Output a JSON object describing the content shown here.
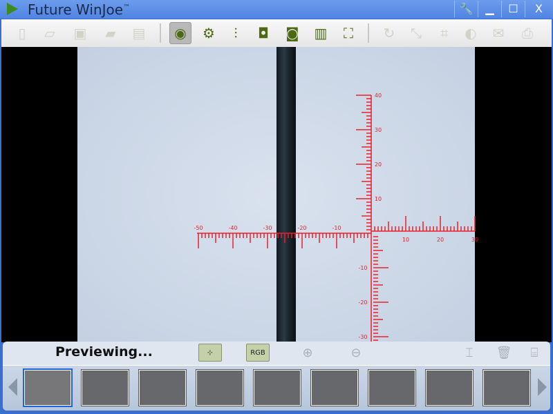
{
  "window": {
    "title": "Future WinJoe",
    "trademark": "™",
    "controls": {
      "settings": "🔧",
      "minimize": "▁",
      "maximize": "☐",
      "close": "X"
    }
  },
  "toolbar": {
    "items": [
      {
        "icon": "new-file-icon",
        "glyph": "▯",
        "enabled": false
      },
      {
        "icon": "copy-icon",
        "glyph": "▱",
        "enabled": false
      },
      {
        "icon": "save-as-icon",
        "glyph": "▣",
        "enabled": false
      },
      {
        "icon": "open-folder-icon",
        "glyph": "▰",
        "enabled": false
      },
      {
        "icon": "save-icon",
        "glyph": "▤",
        "enabled": false
      },
      {
        "icon": "webcam-icon",
        "glyph": "◉",
        "enabled": true,
        "selected": true
      },
      {
        "icon": "gear-icon",
        "glyph": "⚙",
        "enabled": true
      },
      {
        "icon": "sliders-icon",
        "glyph": "⫶",
        "enabled": true
      },
      {
        "icon": "camera-icon",
        "glyph": "◘",
        "enabled": true
      },
      {
        "icon": "burst-camera-icon",
        "glyph": "◙",
        "enabled": true
      },
      {
        "icon": "video-icon",
        "glyph": "▥",
        "enabled": true
      },
      {
        "icon": "fullscreen-icon",
        "glyph": "⛶",
        "enabled": true
      },
      {
        "icon": "rotate-icon",
        "glyph": "↻",
        "enabled": false
      },
      {
        "icon": "resize-icon",
        "glyph": "⤡",
        "enabled": false
      },
      {
        "icon": "crop-icon",
        "glyph": "⌗",
        "enabled": false
      },
      {
        "icon": "contrast-icon",
        "glyph": "◐",
        "enabled": false
      },
      {
        "icon": "email-icon",
        "glyph": "✉",
        "enabled": false
      },
      {
        "icon": "print-icon",
        "glyph": "⎙",
        "enabled": false
      }
    ]
  },
  "reticle": {
    "color": "#e8202a",
    "h_left_labels": [
      "-50",
      "-40",
      "-30",
      "-20",
      "-10"
    ],
    "h_right_labels": [
      "10",
      "20",
      "30"
    ],
    "v_up_labels": [
      "10",
      "20",
      "30",
      "40"
    ],
    "v_down_labels": [
      "-10",
      "-20",
      "-30"
    ]
  },
  "bottom": {
    "status": "Previewing...",
    "buttons": [
      {
        "icon": "reticle-toggle-icon",
        "label": "⊹"
      },
      {
        "icon": "rgb-icon",
        "label": "RGB"
      },
      {
        "icon": "zoom-in-icon",
        "label": "⊕"
      },
      {
        "icon": "zoom-out-icon",
        "label": "⊖"
      },
      {
        "icon": "compare-icon",
        "label": "⌶"
      },
      {
        "icon": "delete-icon",
        "label": "🗑"
      },
      {
        "icon": "delete-all-icon",
        "label": "⌸"
      }
    ],
    "thumbnails": 9,
    "selected_thumbnail": 0
  }
}
